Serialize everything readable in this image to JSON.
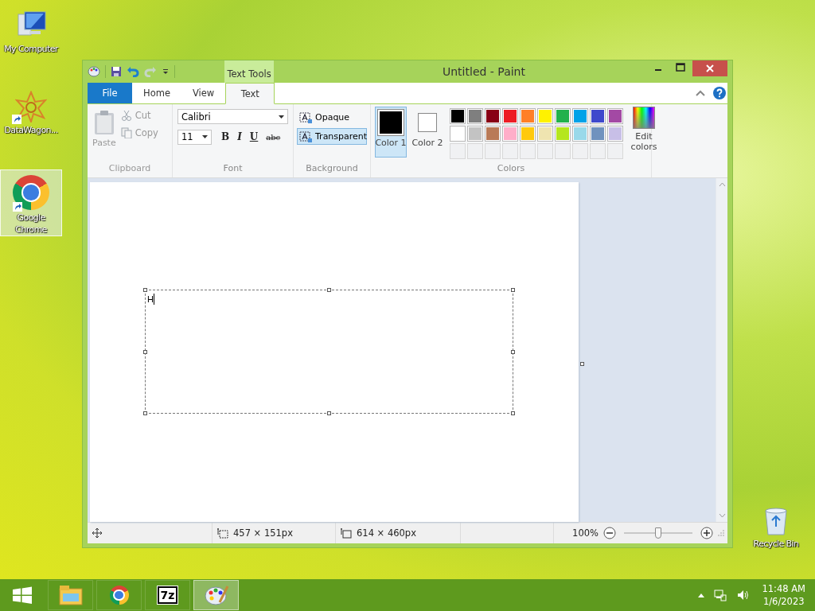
{
  "desktop_icons": [
    {
      "label": "My Computer",
      "kind": "computer",
      "selected": false
    },
    {
      "label": "DataWagon...",
      "kind": "star",
      "selected": false
    },
    {
      "label": "Google Chrome",
      "kind": "chrome",
      "selected": true
    },
    {
      "label": "Recycle Bin",
      "kind": "bin",
      "selected": false
    }
  ],
  "window": {
    "title": "Untitled - Paint",
    "context_group": "Text Tools",
    "tabs": [
      {
        "label": "File",
        "kind": "file",
        "selected": false
      },
      {
        "label": "Home",
        "kind": "tab",
        "selected": false
      },
      {
        "label": "View",
        "kind": "tab",
        "selected": false
      },
      {
        "label": "Text",
        "kind": "tab",
        "selected": true
      }
    ],
    "clipboard": {
      "label": "Clipboard",
      "paste": "Paste",
      "cut": "Cut",
      "copy": "Copy",
      "disabled": true
    },
    "font": {
      "label": "Font",
      "family": "Calibri",
      "size": "11",
      "bold": "B",
      "italic": "I",
      "underline": "U",
      "strikethrough": "abc"
    },
    "background": {
      "label": "Background",
      "options": [
        {
          "label": "Opaque",
          "selected": false
        },
        {
          "label": "Transparent",
          "selected": true
        }
      ]
    },
    "colors": {
      "label": "Colors",
      "edit": "Edit colors",
      "current": [
        {
          "label": "Color 1",
          "color": "#000000",
          "selected": true
        },
        {
          "label": "Color 2",
          "color": "#ffffff",
          "selected": false
        }
      ],
      "palette": [
        {
          "kind": "swatch",
          "color": "#000000"
        },
        {
          "kind": "swatch",
          "color": "#7f7f7f"
        },
        {
          "kind": "swatch",
          "color": "#880015"
        },
        {
          "kind": "swatch",
          "color": "#ed1c24"
        },
        {
          "kind": "swatch",
          "color": "#ff7f27"
        },
        {
          "kind": "swatch",
          "color": "#fff200"
        },
        {
          "kind": "swatch",
          "color": "#22b14c"
        },
        {
          "kind": "swatch",
          "color": "#00a2e8"
        },
        {
          "kind": "swatch",
          "color": "#3f48cc"
        },
        {
          "kind": "swatch",
          "color": "#a349a4"
        },
        {
          "kind": "swatch",
          "color": "#ffffff"
        },
        {
          "kind": "swatch",
          "color": "#c3c3c3"
        },
        {
          "kind": "swatch",
          "color": "#b97a57"
        },
        {
          "kind": "swatch",
          "color": "#ffaec9"
        },
        {
          "kind": "swatch",
          "color": "#ffc90e"
        },
        {
          "kind": "swatch",
          "color": "#efe4b0"
        },
        {
          "kind": "swatch",
          "color": "#b5e61d"
        },
        {
          "kind": "swatch",
          "color": "#99d9ea"
        },
        {
          "kind": "swatch",
          "color": "#7092be"
        },
        {
          "kind": "swatch",
          "color": "#c8bfe7"
        },
        {
          "kind": "empty"
        },
        {
          "kind": "empty"
        },
        {
          "kind": "empty"
        },
        {
          "kind": "empty"
        },
        {
          "kind": "empty"
        },
        {
          "kind": "empty"
        },
        {
          "kind": "empty"
        },
        {
          "kind": "empty"
        },
        {
          "kind": "empty"
        },
        {
          "kind": "empty"
        }
      ]
    },
    "canvas": {
      "text": "H"
    },
    "status_bar": {
      "selection_size": "457 × 151px",
      "canvas_size": "614 × 460px",
      "zoom": "100%",
      "level": 0.5
    }
  },
  "taskbar": {
    "items": [
      {
        "kind": "explorer",
        "selected": false
      },
      {
        "kind": "chrome",
        "selected": false
      },
      {
        "kind": "sevenzip",
        "label": "7z",
        "selected": false
      },
      {
        "kind": "paint",
        "selected": true
      }
    ],
    "time": "11:48 AM",
    "date": "1/6/2023"
  }
}
